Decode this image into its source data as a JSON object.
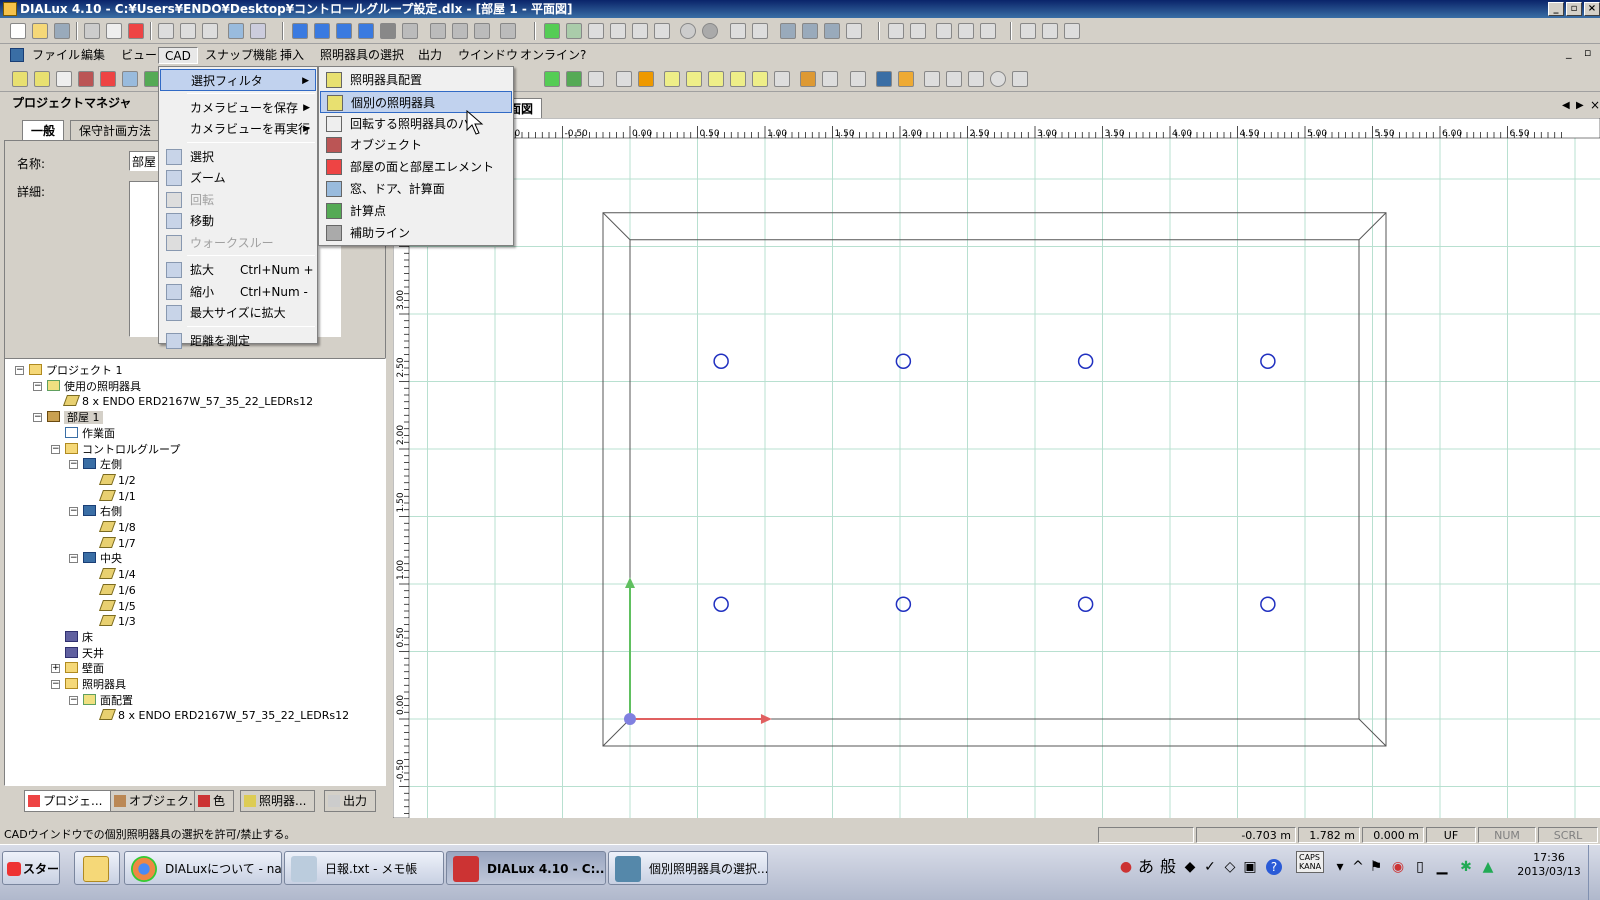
{
  "window": {
    "title": "DIALux 4.10 - C:¥Users¥ENDO¥Desktop¥コントロールグループ設定.dlx - [部屋 1 - 平面図]"
  },
  "menubar": {
    "items": [
      "ファイル",
      "編集",
      "ビュー",
      "CAD",
      "スナップ機能",
      "挿入",
      "照明器具の選択",
      "出力",
      "ウインドウ",
      "オンライン",
      "?"
    ],
    "active": "CAD"
  },
  "project_manager": {
    "title": "プロジェクトマネジャ",
    "tabs": [
      "一般",
      "保守計画方法"
    ],
    "name_label": "名称:",
    "name_value": "部屋",
    "detail_label": "詳細:"
  },
  "tree": [
    {
      "label": "プロジェクト 1",
      "depth": 0,
      "icon": "folder-icon",
      "expander": "−"
    },
    {
      "label": "使用の照明器具",
      "depth": 1,
      "icon": "luminaire-group-icon",
      "expander": "−"
    },
    {
      "label": "8 x ENDO ERD2167W_57_35_22_LEDRs12",
      "depth": 2,
      "icon": "luminaire-icon",
      "expander": ""
    },
    {
      "label": "部屋 1",
      "depth": 1,
      "icon": "room-icon",
      "expander": "−",
      "selected": true
    },
    {
      "label": "作業面",
      "depth": 2,
      "icon": "work-plane-icon",
      "expander": ""
    },
    {
      "label": "コントロルグループ",
      "depth": 2,
      "icon": "folder-icon",
      "expander": "−"
    },
    {
      "label": "左側",
      "depth": 3,
      "icon": "control-group-icon",
      "expander": "−"
    },
    {
      "label": "1/2",
      "depth": 4,
      "icon": "luminaire-icon",
      "expander": ""
    },
    {
      "label": "1/1",
      "depth": 4,
      "icon": "luminaire-icon",
      "expander": ""
    },
    {
      "label": "右側",
      "depth": 3,
      "icon": "control-group-icon",
      "expander": "−"
    },
    {
      "label": "1/8",
      "depth": 4,
      "icon": "luminaire-icon",
      "expander": ""
    },
    {
      "label": "1/7",
      "depth": 4,
      "icon": "luminaire-icon",
      "expander": ""
    },
    {
      "label": "中央",
      "depth": 3,
      "icon": "control-group-icon",
      "expander": "−"
    },
    {
      "label": "1/4",
      "depth": 4,
      "icon": "luminaire-icon",
      "expander": ""
    },
    {
      "label": "1/6",
      "depth": 4,
      "icon": "luminaire-icon",
      "expander": ""
    },
    {
      "label": "1/5",
      "depth": 4,
      "icon": "luminaire-icon",
      "expander": ""
    },
    {
      "label": "1/3",
      "depth": 4,
      "icon": "luminaire-icon",
      "expander": ""
    },
    {
      "label": "床",
      "depth": 2,
      "icon": "floor-icon",
      "expander": ""
    },
    {
      "label": "天井",
      "depth": 2,
      "icon": "ceiling-icon",
      "expander": ""
    },
    {
      "label": "壁面",
      "depth": 2,
      "icon": "folder-icon",
      "expander": "+"
    },
    {
      "label": "照明器具",
      "depth": 2,
      "icon": "folder-icon",
      "expander": "−"
    },
    {
      "label": "面配置",
      "depth": 3,
      "icon": "luminaire-group-icon",
      "expander": "−"
    },
    {
      "label": "8 x ENDO ERD2167W_57_35_22_LEDRs12",
      "depth": 4,
      "icon": "luminaire-icon",
      "expander": ""
    }
  ],
  "bottom_tabs": [
    "プロジェ...",
    "オブジェク...",
    "色",
    "照明器...",
    "出力"
  ],
  "cad_menu": {
    "items": [
      {
        "label": "選択フィルタ",
        "icon": "",
        "submenu": true,
        "highlight": true
      },
      {
        "sep": true
      },
      {
        "label": "カメラビューを保存",
        "icon": "",
        "submenu": true
      },
      {
        "label": "カメラビューを再実行",
        "icon": "",
        "submenu": true
      },
      {
        "sep": true
      },
      {
        "label": "選択",
        "icon": "select-arrow-icon"
      },
      {
        "label": "ズーム",
        "icon": "zoom-icon"
      },
      {
        "label": "回転",
        "icon": "rotate-icon",
        "disabled": true
      },
      {
        "label": "移動",
        "icon": "hand-pan-icon"
      },
      {
        "label": "ウォークスルー",
        "icon": "walkthrough-icon",
        "disabled": true
      },
      {
        "sep": true
      },
      {
        "label": "拡大",
        "shortcut": "Ctrl+Num +",
        "icon": "zoom-in-icon"
      },
      {
        "label": "縮小",
        "shortcut": "Ctrl+Num -",
        "icon": "zoom-out-icon"
      },
      {
        "label": "最大サイズに拡大",
        "icon": "zoom-extents-icon"
      },
      {
        "sep": true
      },
      {
        "label": "距離を測定",
        "icon": "measure-icon"
      }
    ]
  },
  "filter_submenu": {
    "items": [
      {
        "label": "照明器具配置",
        "icon": "luminaire-arrangement-icon"
      },
      {
        "label": "個別の照明器具",
        "icon": "single-luminaire-icon",
        "highlight": true
      },
      {
        "label": "回転する照明器具のパ",
        "icon": "rotate-luminaire-icon"
      },
      {
        "label": "オブジェクト",
        "icon": "object-icon"
      },
      {
        "label": "部屋の面と部屋エレメント",
        "icon": "room-surface-icon"
      },
      {
        "label": "窓、ドア、計算面",
        "icon": "window-door-icon"
      },
      {
        "label": "計算点",
        "icon": "calc-point-icon"
      },
      {
        "label": "補助ライン",
        "icon": "aux-line-icon"
      }
    ]
  },
  "canvas": {
    "tab_label": "面図",
    "ruler_x": [
      "-1.00",
      "-0.50",
      "0.00",
      "0.50",
      "1.00",
      "1.50",
      "2.00",
      "2.50",
      "3.00",
      "3.50",
      "4.00",
      "4.50",
      "5.00",
      "5.50",
      "6.00",
      "6.50"
    ],
    "ruler_y": [
      "3.00",
      "2.50",
      "2.00",
      "1.50",
      "1.00",
      "0.50",
      "0.00",
      "-0.50"
    ],
    "luminaires_count": 8
  },
  "status": {
    "message": "CADウインドウでの個別照明器具の選択を許可/禁止する。",
    "x": "-0.703 m",
    "y": "1.782 m",
    "z": "0.000 m",
    "uf": "UF",
    "num": "NUM",
    "scrl": "SCRL"
  },
  "taskbar": {
    "start": "スタート",
    "buttons": [
      "DIALuxについて - nag...",
      "日報.txt - メモ帳",
      "DIALux 4.10 - C:...",
      "個別照明器具の選択..."
    ],
    "active_index": 2,
    "ime": [
      "あ",
      "般"
    ],
    "caps": "CAPS",
    "kana": "KANA",
    "time": "17:36",
    "date": "2013/03/13"
  },
  "colors": {
    "titlebar": "#0a246a",
    "menu_highlight": "#c1d2ee",
    "luminaire_circle": "#2030c0",
    "axis_x": "#e06060",
    "axis_y": "#60c060",
    "grid": "#b8e0d0"
  }
}
